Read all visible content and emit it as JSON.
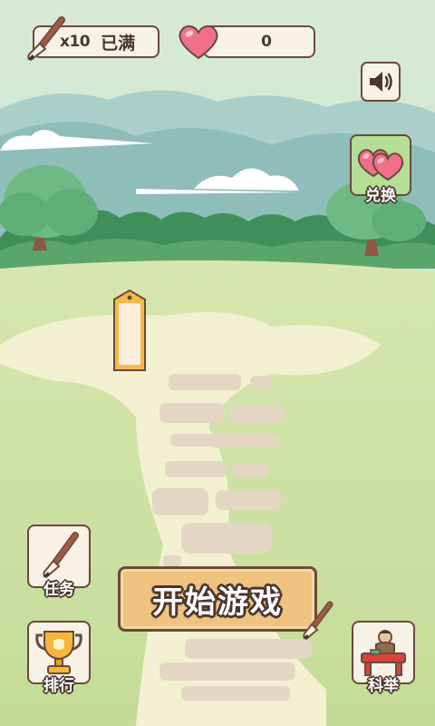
{
  "hud": {
    "brush_count": "x10",
    "brush_status": "已满",
    "hearts": "0"
  },
  "exchange": {
    "label": "兑换"
  },
  "tasks": {
    "label": "任务"
  },
  "ranking": {
    "label": "排行"
  },
  "exam": {
    "label": "科举"
  },
  "start": {
    "label": "开始游戏"
  },
  "icons": {
    "brush": "brush-icon",
    "heart": "heart-icon",
    "sound": "speaker-icon",
    "exchange": "hearts-icon",
    "trophy": "trophy-icon",
    "scholar": "scholar-desk-icon",
    "tag": "blank-tag-icon"
  },
  "colors": {
    "outline": "#6b4a3a",
    "panel": "#f7f1e6",
    "start_button": "#f0c27f",
    "exchange_button": "#b6dd95",
    "sky": "#cfe4cc",
    "grass": "#cfe0a8",
    "path": "#f3f0d2",
    "heart": "#f0708a"
  }
}
